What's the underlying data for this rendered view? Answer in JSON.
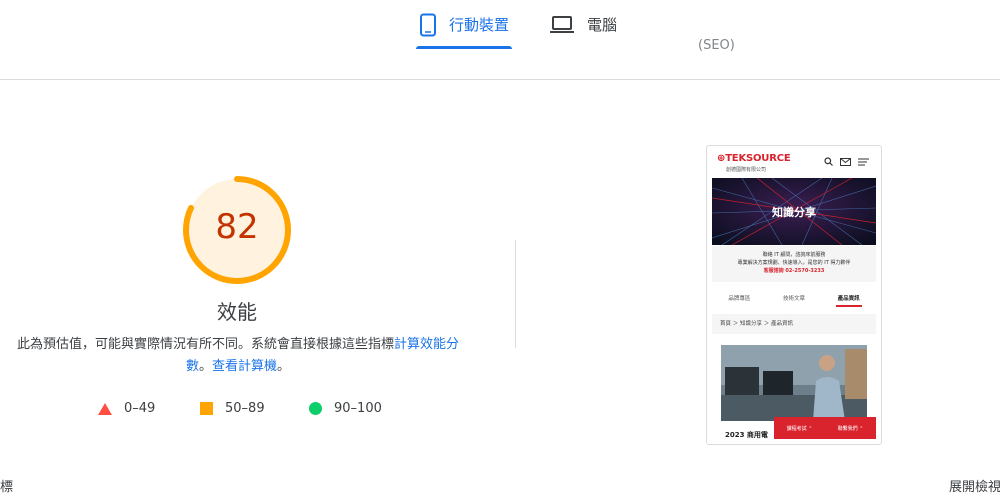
{
  "tabs": {
    "mobile_label": "行動裝置",
    "desktop_label": "電腦",
    "peek_text": "(SEO)"
  },
  "gauge": {
    "score": 82,
    "score_text": "82",
    "title": "效能",
    "color": "#ffa400",
    "text_color": "#c33300"
  },
  "description": {
    "text": "此為預估值，可能與實際情況有所不同。系統會直接根據這些指標",
    "link1": "計算效能分數",
    "sep": "。",
    "link2": "查看計算機",
    "end": "。"
  },
  "legend": [
    {
      "range": "0–49",
      "shape": "triangle",
      "color": "#ff4e42"
    },
    {
      "range": "50–89",
      "shape": "square",
      "color": "#ffa400"
    },
    {
      "range": "90–100",
      "shape": "circle",
      "color": "#0cce6b"
    }
  ],
  "preview": {
    "logo_prefix": "TEK",
    "logo_suffix": "SOURCE",
    "logo_sub": "創德國際有限公司",
    "hero_title": "知識分享",
    "promo_line1": "聯絡 IT 顧問，諮詢床前服務",
    "promo_line2": "專業解決方案規劃、快速導入，是您的 IT 得力夥伴",
    "promo_phone": "客服諮詢 02-2570-3233",
    "tabs": [
      "品牌專區",
      "技術文章",
      "產品資訊"
    ],
    "breadcrumb": "首頁 ＞ 知識分享 ＞ 產品資訊",
    "article_title": "2023 商用電",
    "btn1": "課程考試 ⌃",
    "btn2": "聯繫我們 ⌃"
  },
  "edge": {
    "left": "標",
    "right": "展開檢視"
  },
  "colors": {
    "accent": "#1a73e8",
    "brand_red": "#d9232d"
  }
}
